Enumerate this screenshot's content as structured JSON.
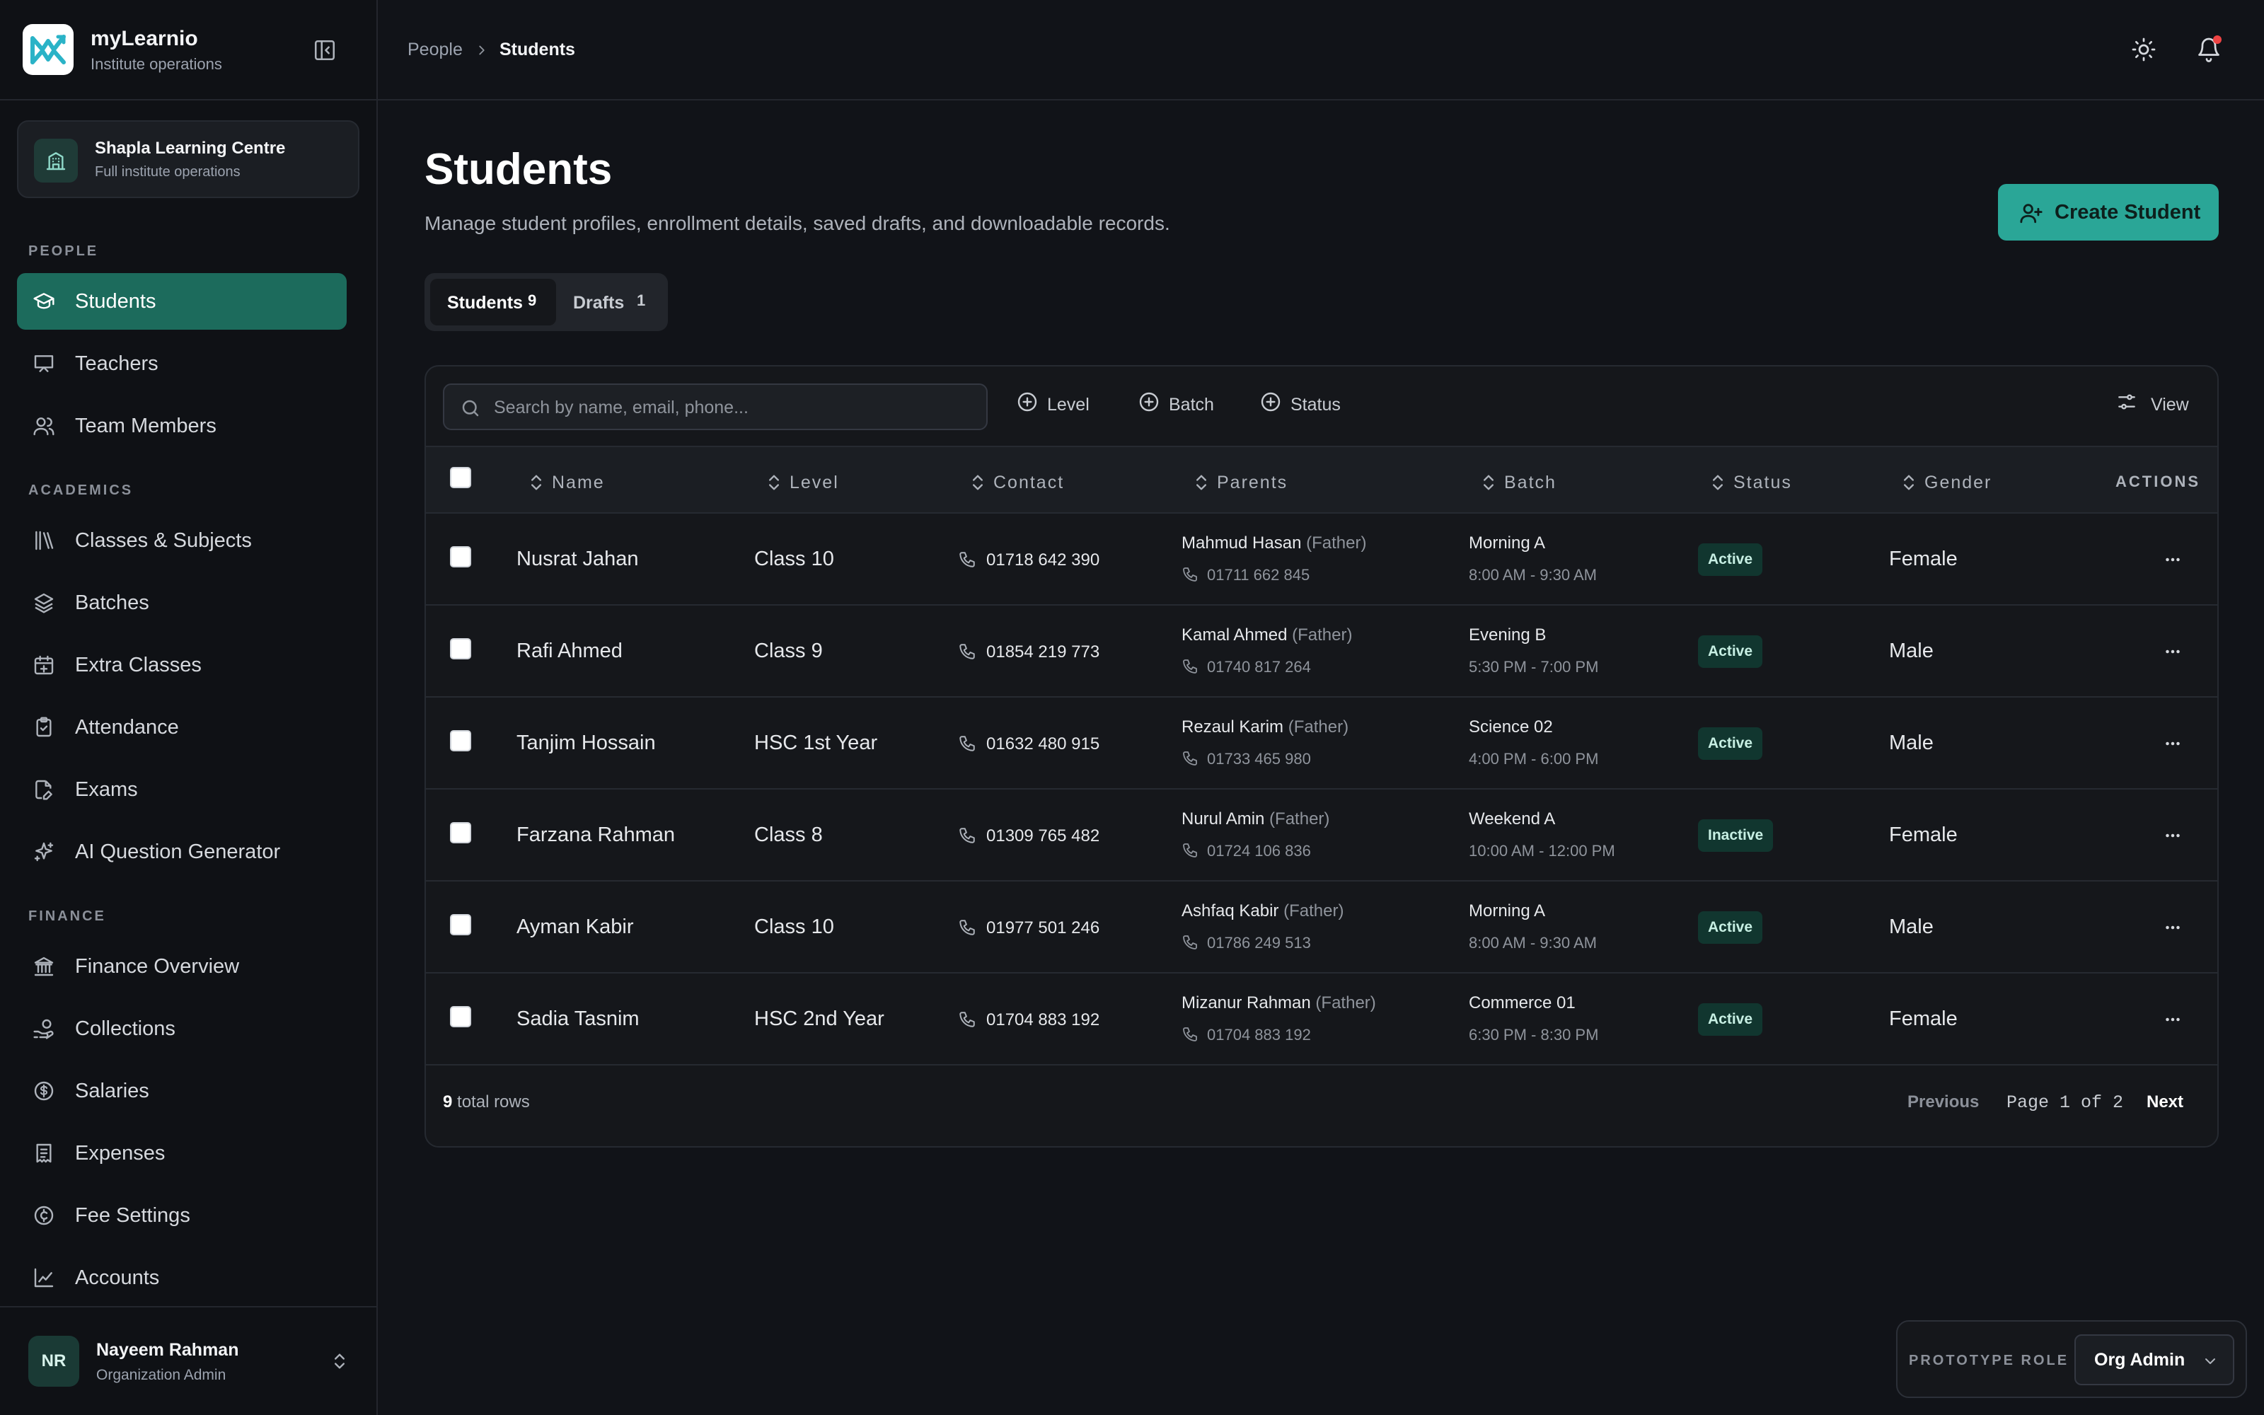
{
  "app": {
    "name": "myLearnio",
    "subtitle": "Institute operations"
  },
  "org": {
    "name": "Shapla Learning Centre",
    "subtitle": "Full institute operations"
  },
  "sidebar": {
    "sections": {
      "people": "PEOPLE",
      "academics": "ACADEMICS",
      "finance": "FINANCE"
    },
    "items": [
      {
        "label": "Students",
        "icon": "graduation-cap-icon",
        "active": true
      },
      {
        "label": "Teachers",
        "icon": "presentation-icon"
      },
      {
        "label": "Team Members",
        "icon": "users-icon"
      },
      {
        "label": "Classes & Subjects",
        "icon": "library-icon"
      },
      {
        "label": "Batches",
        "icon": "layers-icon"
      },
      {
        "label": "Extra Classes",
        "icon": "calendar-plus-icon"
      },
      {
        "label": "Attendance",
        "icon": "clipboard-check-icon"
      },
      {
        "label": "Exams",
        "icon": "file-pen-icon"
      },
      {
        "label": "AI Question Generator",
        "icon": "sparkles-icon"
      },
      {
        "label": "Finance Overview",
        "icon": "landmark-icon"
      },
      {
        "label": "Collections",
        "icon": "hand-coins-icon"
      },
      {
        "label": "Salaries",
        "icon": "dollar-circle-icon"
      },
      {
        "label": "Expenses",
        "icon": "receipt-icon"
      },
      {
        "label": "Fee Settings",
        "icon": "currency-circle-icon"
      },
      {
        "label": "Accounts",
        "icon": "chart-line-icon"
      }
    ]
  },
  "user": {
    "initials": "NR",
    "name": "Nayeem Rahman",
    "role": "Organization Admin"
  },
  "breadcrumb": {
    "parent": "People",
    "current": "Students"
  },
  "page": {
    "title": "Students",
    "description": "Manage student profiles, enrollment details, saved drafts, and downloadable records.",
    "create_label": "Create Student"
  },
  "tabs": [
    {
      "label": "Students",
      "count": "9",
      "active": true
    },
    {
      "label": "Drafts",
      "count": "1"
    }
  ],
  "toolbar": {
    "search_placeholder": "Search by name, email, phone...",
    "filters": [
      "Level",
      "Batch",
      "Status"
    ],
    "view_label": "View"
  },
  "columns": {
    "name": "Name",
    "level": "Level",
    "contact": "Contact",
    "parents": "Parents",
    "batch": "Batch",
    "status": "Status",
    "gender": "Gender",
    "actions": "ACTIONS"
  },
  "rows": [
    {
      "name": "Nusrat Jahan",
      "level": "Class 10",
      "contact": "01718 642 390",
      "parent": "Mahmud Hasan",
      "relation": "(Father)",
      "parent_phone": "01711 662 845",
      "batch": "Morning A",
      "time": "8:00 AM - 9:30 AM",
      "status": "Active",
      "gender": "Female"
    },
    {
      "name": "Rafi Ahmed",
      "level": "Class 9",
      "contact": "01854 219 773",
      "parent": "Kamal Ahmed",
      "relation": "(Father)",
      "parent_phone": "01740 817 264",
      "batch": "Evening B",
      "time": "5:30 PM - 7:00 PM",
      "status": "Active",
      "gender": "Male"
    },
    {
      "name": "Tanjim Hossain",
      "level": "HSC 1st Year",
      "contact": "01632 480 915",
      "parent": "Rezaul Karim",
      "relation": "(Father)",
      "parent_phone": "01733 465 980",
      "batch": "Science 02",
      "time": "4:00 PM - 6:00 PM",
      "status": "Active",
      "gender": "Male"
    },
    {
      "name": "Farzana Rahman",
      "level": "Class 8",
      "contact": "01309 765 482",
      "parent": "Nurul Amin",
      "relation": "(Father)",
      "parent_phone": "01724 106 836",
      "batch": "Weekend A",
      "time": "10:00 AM - 12:00 PM",
      "status": "Inactive",
      "gender": "Female"
    },
    {
      "name": "Ayman Kabir",
      "level": "Class 10",
      "contact": "01977 501 246",
      "parent": "Ashfaq Kabir",
      "relation": "(Father)",
      "parent_phone": "01786 249 513",
      "batch": "Morning A",
      "time": "8:00 AM - 9:30 AM",
      "status": "Active",
      "gender": "Male"
    },
    {
      "name": "Sadia Tasnim",
      "level": "HSC 2nd Year",
      "contact": "01704 883 192",
      "parent": "Mizanur Rahman",
      "relation": "(Father)",
      "parent_phone": "01704 883 192",
      "batch": "Commerce 01",
      "time": "6:30 PM - 8:30 PM",
      "status": "Active",
      "gender": "Female"
    }
  ],
  "footer": {
    "total_count": "9",
    "total_label": "total rows",
    "previous": "Previous",
    "page_indicator": "Page 1 of 2",
    "next": "Next"
  },
  "prototype": {
    "label": "PROTOTYPE ROLE",
    "value": "Org Admin"
  },
  "colors": {
    "accent": "#2aa697",
    "active_nav": "#1c6b5c",
    "background": "#111318",
    "badge_bg": "#11362f",
    "notification_dot": "#ef4444"
  }
}
